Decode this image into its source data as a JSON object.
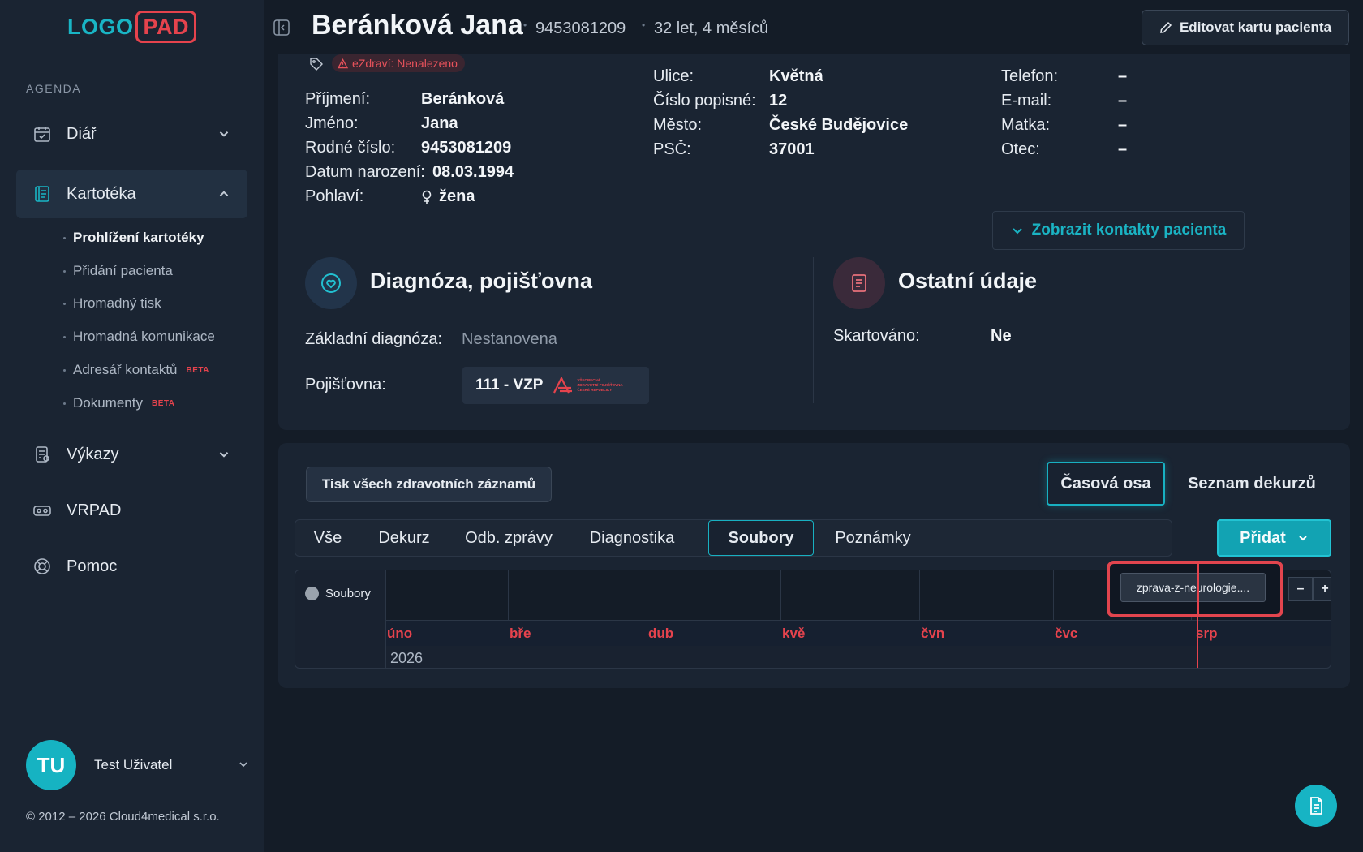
{
  "logo": {
    "part_a": "LOGO",
    "part_b": "PAD"
  },
  "sidebar": {
    "section_label": "AGENDA",
    "items": [
      {
        "label": "Diář",
        "icon": "calendar-icon"
      },
      {
        "label": "Kartotéka",
        "icon": "book-icon"
      },
      {
        "label": "Výkazy",
        "icon": "report-icon"
      },
      {
        "label": "VRPAD",
        "icon": "vr-icon"
      },
      {
        "label": "Pomoc",
        "icon": "lifebuoy-icon"
      }
    ],
    "sub_items": [
      {
        "label": "Prohlížení kartotéky"
      },
      {
        "label": "Přidání pacienta"
      },
      {
        "label": "Hromadný tisk"
      },
      {
        "label": "Hromadná komunikace"
      },
      {
        "label": "Adresář kontaktů",
        "badge": "BETA"
      },
      {
        "label": "Dokumenty",
        "badge": "BETA"
      }
    ],
    "user": {
      "initials": "TU",
      "name": "Test Uživatel"
    },
    "copyright": "© 2012 – 2026 Cloud4medical s.r.o."
  },
  "header": {
    "patient_name": "Beránková Jana",
    "birth_number": "9453081209",
    "age": "32 let, 4 měsíců",
    "edit_button": "Editovat kartu pacienta"
  },
  "patient": {
    "ezdravi": "eZdraví: Nenalezeno",
    "col1": [
      {
        "label": "Příjmení:",
        "value": "Beránková"
      },
      {
        "label": "Jméno:",
        "value": "Jana"
      },
      {
        "label": "Rodné číslo:",
        "value": "9453081209"
      },
      {
        "label": "Datum narození:",
        "value": "08.03.1994"
      },
      {
        "label": "Pohlaví:",
        "value": "žena"
      }
    ],
    "col2": [
      {
        "label": "Ulice:",
        "value": "Květná"
      },
      {
        "label": "Číslo popisné:",
        "value": "12"
      },
      {
        "label": "Město:",
        "value": "České Budějovice"
      },
      {
        "label": "PSČ:",
        "value": "37001"
      }
    ],
    "col3": [
      {
        "label": "Telefon:",
        "value": "–"
      },
      {
        "label": "E-mail:",
        "value": "–"
      },
      {
        "label": "Matka:",
        "value": "–"
      },
      {
        "label": "Otec:",
        "value": "–"
      }
    ],
    "show_contacts": "Zobrazit kontakty pacienta"
  },
  "diagnosis": {
    "title": "Diagnóza, pojišťovna",
    "basic_label": "Základní diagnóza:",
    "basic_value": "Nestanovena",
    "insurer_label": "Pojišťovna:",
    "insurer_value": "111 - VZP",
    "insurer_logo_text": [
      "VŠEOBECNÁ",
      "ZDRAVOTNÍ POJIŠŤOVNA",
      "ČESKÉ REPUBLIKY"
    ]
  },
  "other": {
    "title": "Ostatní údaje",
    "shredded_label": "Skartováno:",
    "shredded_value": "Ne"
  },
  "records": {
    "print_button": "Tisk všech zdravotních záznamů",
    "view_timeline": "Časová osa",
    "view_list": "Seznam dekurzů",
    "tabs": [
      "Vše",
      "Dekurz",
      "Odb. zprávy",
      "Diagnostika",
      "Soubory",
      "Poznámky"
    ],
    "active_tab": "Soubory",
    "add_button": "Přidat"
  },
  "timeline": {
    "row_label": "Soubory",
    "months": [
      "úno",
      "bře",
      "dub",
      "kvě",
      "čvn",
      "čvc",
      "srp"
    ],
    "year": "2026",
    "file_chip": "zprava-z-neurologie....",
    "zoom_out": "–",
    "zoom_in": "+"
  },
  "colors": {
    "accent": "#18b0c1",
    "danger": "#e5434d",
    "background": "#141c27",
    "card": "#1a2432"
  }
}
